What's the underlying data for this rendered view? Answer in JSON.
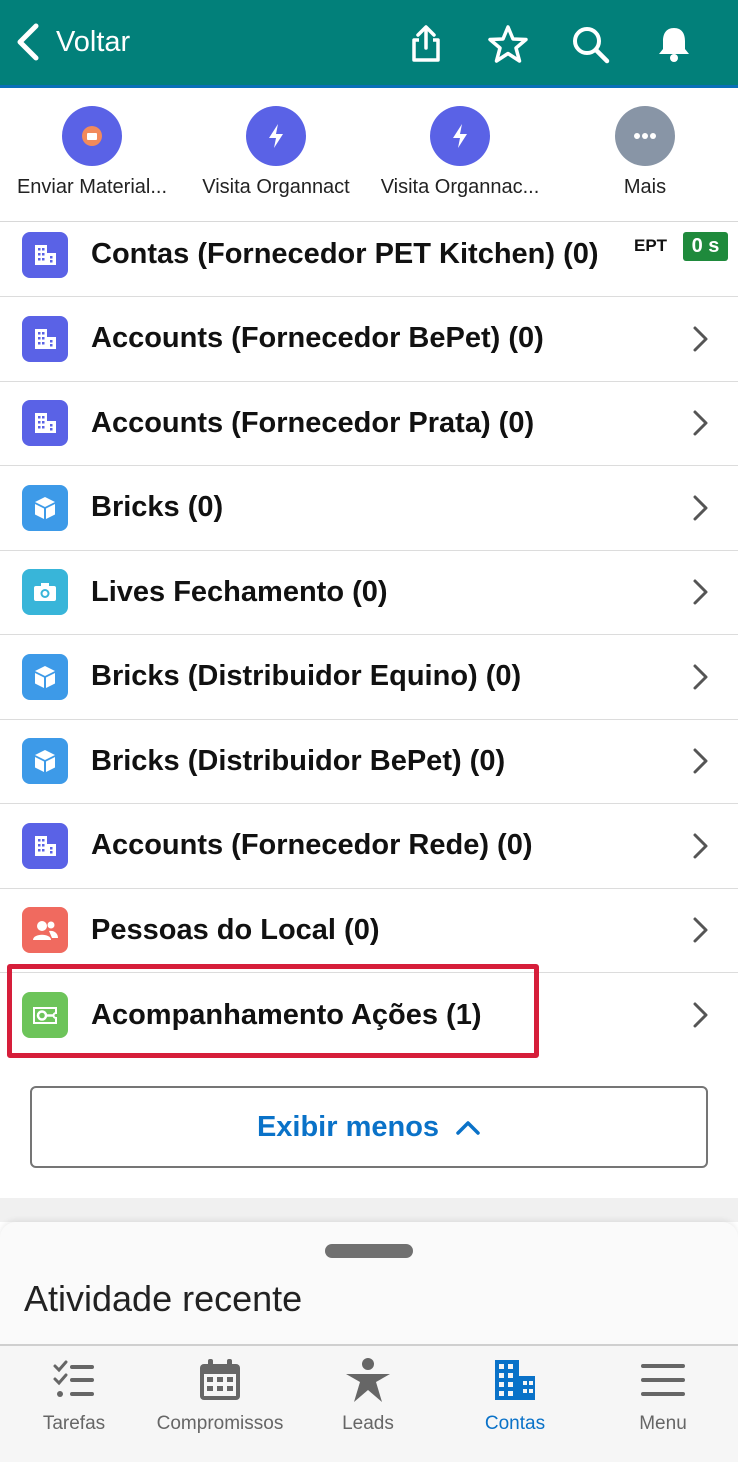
{
  "header": {
    "back_label": "Voltar",
    "bg_color": "#02807a",
    "icons": [
      "share-icon",
      "star-icon",
      "search-icon",
      "bell-icon"
    ]
  },
  "actions": [
    {
      "label": "Enviar Material...",
      "icon": "send-material-icon",
      "color": "#5a62e6"
    },
    {
      "label": "Visita Organnact",
      "icon": "lightning-icon",
      "color": "#5a62e6"
    },
    {
      "label": "Visita Organnac...",
      "icon": "lightning-icon",
      "color": "#5a62e6"
    },
    {
      "label": "Mais",
      "icon": "more-icon",
      "color": "#8895a6"
    }
  ],
  "related_lists": [
    {
      "label": "Contas (Fornecedor PET Kitchen) (0)",
      "icon": "building-icon",
      "color": "#5a62e6"
    },
    {
      "label": "Accounts (Fornecedor BePet) (0)",
      "icon": "building-icon",
      "color": "#5a62e6"
    },
    {
      "label": "Accounts (Fornecedor Prata) (0)",
      "icon": "building-icon",
      "color": "#5a62e6"
    },
    {
      "label": "Bricks (0)",
      "icon": "cube-icon",
      "color": "#3d9ae8"
    },
    {
      "label": "Lives Fechamento (0)",
      "icon": "camera-icon",
      "color": "#38b5d9"
    },
    {
      "label": "Bricks (Distribuidor Equino) (0)",
      "icon": "cube-icon",
      "color": "#3d9ae8"
    },
    {
      "label": "Bricks (Distribuidor BePet) (0)",
      "icon": "cube-icon",
      "color": "#3d9ae8"
    },
    {
      "label": "Accounts (Fornecedor Rede) (0)",
      "icon": "building-icon",
      "color": "#5a62e6"
    },
    {
      "label": "Pessoas do Local (0)",
      "icon": "people-icon",
      "color": "#f06a5f"
    },
    {
      "label": "Acompanhamento Ações (1)",
      "icon": "ticket-icon",
      "color": "#6dc45a"
    }
  ],
  "overlay_badge": {
    "ept": "EPT",
    "timer": "0 s"
  },
  "show_less_label": "Exibir menos",
  "sheet_title": "Atividade recente",
  "tabs": [
    {
      "label": "Tarefas",
      "icon": "tasks-icon",
      "active": false
    },
    {
      "label": "Compromissos",
      "icon": "calendar-icon",
      "active": false
    },
    {
      "label": "Leads",
      "icon": "leads-icon",
      "active": false
    },
    {
      "label": "Contas",
      "icon": "accounts-icon",
      "active": true
    },
    {
      "label": "Menu",
      "icon": "menu-icon",
      "active": false
    }
  ],
  "accent_color": "#0a72c8",
  "highlight_color": "#d61e3a"
}
